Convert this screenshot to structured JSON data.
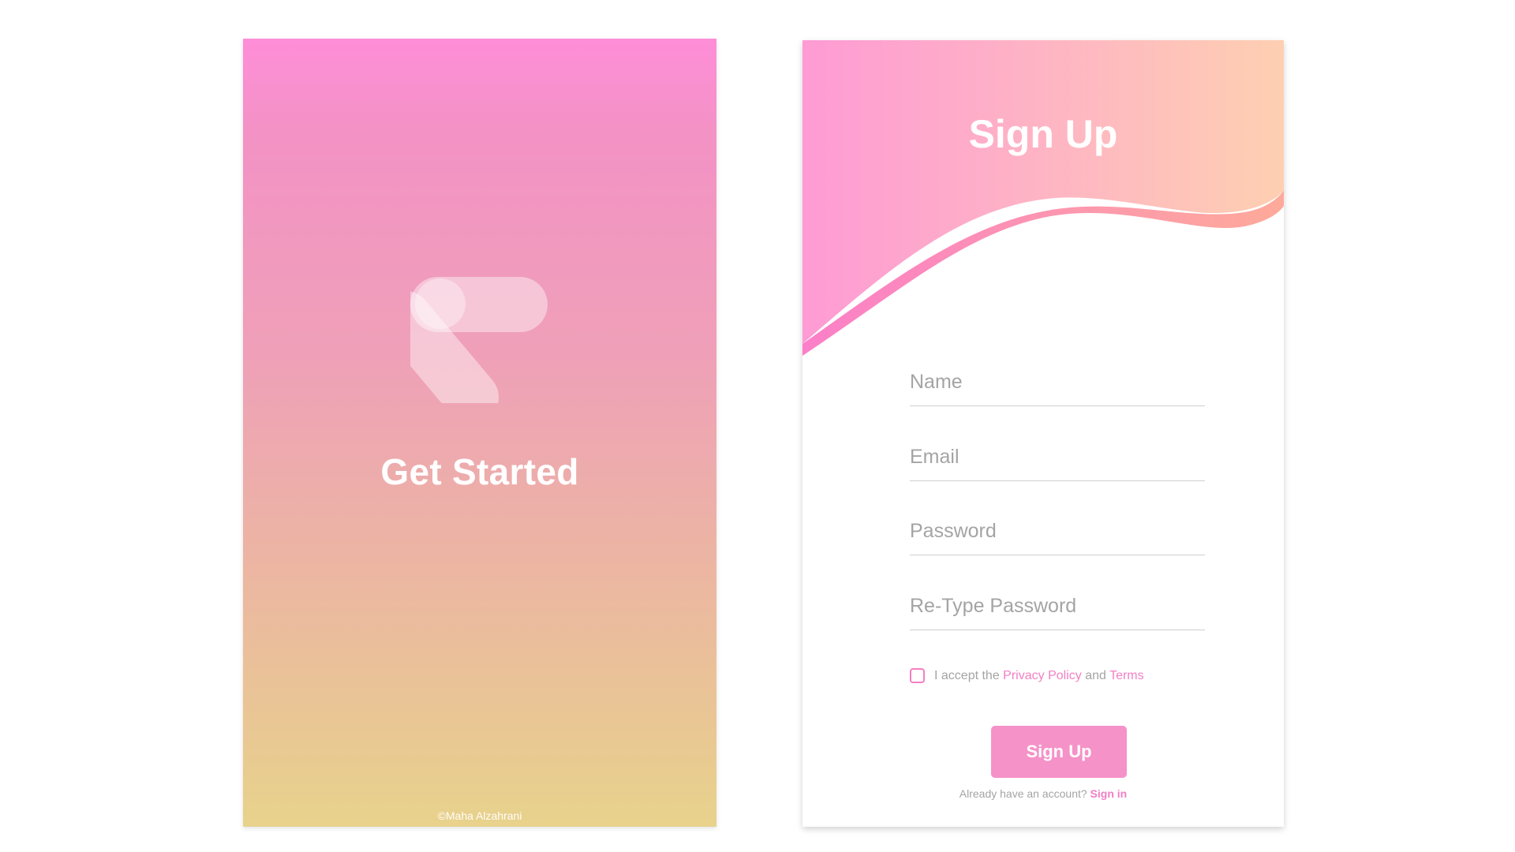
{
  "get_started_screen": {
    "logo_icon": "v-logo-icon",
    "title": "Get Started",
    "copyright": "©Maha Alzahrani"
  },
  "signup_screen": {
    "title": "Sign Up",
    "fields": {
      "name_placeholder": "Name",
      "email_placeholder": "Email",
      "password_placeholder": "Password",
      "retype_password_placeholder": "Re-Type Password"
    },
    "terms": {
      "prefix": "I accept the",
      "privacy_link": "Privacy Policy",
      "conjunction": "and",
      "terms_link": "Terms",
      "checked": false
    },
    "submit_label": "Sign Up",
    "signin_prompt": "Already have an account?",
    "signin_link": "Sign in"
  },
  "colors": {
    "accent_pink": "#f27fc4",
    "button_pink": "#f592c8",
    "gradient_top": "#fe8ed8",
    "gradient_bottom": "#e8d28c",
    "header_gradient_right": "#fecdb2"
  }
}
